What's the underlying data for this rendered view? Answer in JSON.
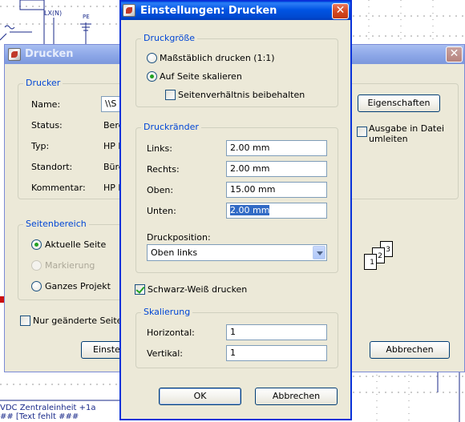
{
  "background": {
    "pe_label": "PE",
    "lx_label": "LX(N)",
    "bottom_text_1": "VDC Zentraleinheit +1a",
    "bottom_text_2": "## [Text fehlt ###"
  },
  "print_dialog": {
    "title": "Drucken",
    "printer_group": "Drucker",
    "name_label": "Name:",
    "name_value": "\\\\S",
    "status_label": "Status:",
    "status_value": "Bere",
    "type_label": "Typ:",
    "type_value": "HP L",
    "location_label": "Standort:",
    "location_value": "Bürc",
    "comment_label": "Kommentar:",
    "comment_value": "HP L",
    "properties_button": "Eigenschaften",
    "print_to_file_label": "Ausgabe in Datei umleiten",
    "page_range_group": "Seitenbereich",
    "current_page": "Aktuelle Seite",
    "selection": "Markierung",
    "whole_project": "Ganzes Projekt",
    "changed_pages_only": "Nur geänderte Seiten",
    "settings_button": "Einste",
    "cancel_button": "Abbrechen",
    "collate_pages": [
      "1",
      "2",
      "3"
    ]
  },
  "settings_dialog": {
    "title": "Einstellungen: Drucken",
    "print_size_group": "Druckgröße",
    "scale_option": "Maßstäblich drucken (1:1)",
    "fit_option": "Auf Seite skalieren",
    "keep_ratio": "Seitenverhältnis beibehalten",
    "margins_group": "Druckränder",
    "left_label": "Links:",
    "left_value": "2.00 mm",
    "right_label": "Rechts:",
    "right_value": "2.00 mm",
    "top_label": "Oben:",
    "top_value": "15.00 mm",
    "bottom_label": "Unten:",
    "bottom_value": "2.00 mm",
    "position_label": "Druckposition:",
    "position_value": "Oben links",
    "bw_print": "Schwarz-Weiß drucken",
    "scaling_group": "Skalierung",
    "horizontal_label": "Horizontal:",
    "horizontal_value": "1",
    "vertical_label": "Vertikal:",
    "vertical_value": "1",
    "ok_button": "OK",
    "cancel_button": "Abbrechen"
  },
  "colors": {
    "titlebar_active": "#0054e3",
    "dialog_face": "#ece9d8",
    "group_label": "#0046d5",
    "selection": "#316ac5"
  }
}
